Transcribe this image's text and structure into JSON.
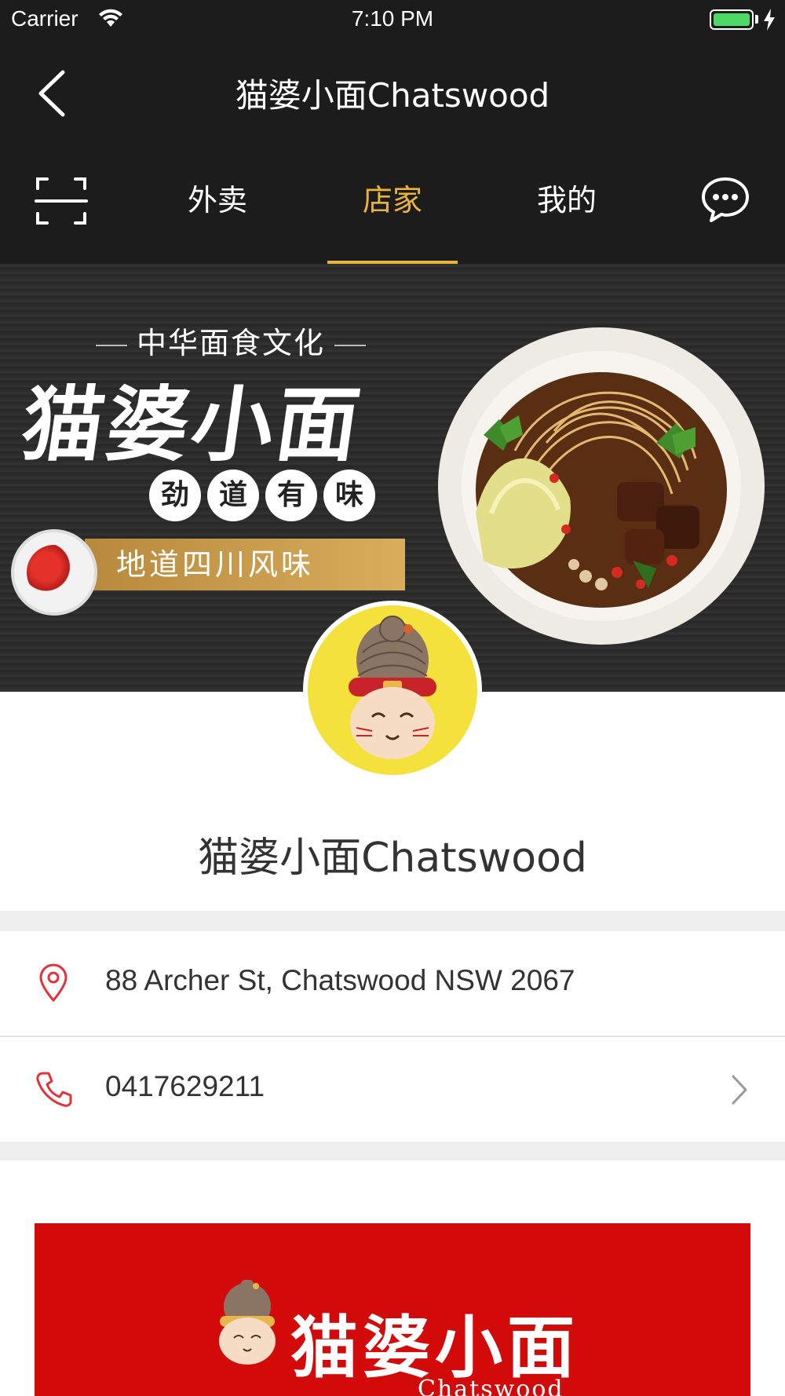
{
  "status_bar": {
    "carrier": "Carrier",
    "time": "7:10 PM",
    "battery_color": "#4cd964"
  },
  "nav": {
    "title": "猫婆小面Chatswood",
    "back_icon": "chevron-left-icon"
  },
  "tabs": {
    "scan_icon": "scan-icon",
    "items": [
      {
        "label": "外卖",
        "active": false
      },
      {
        "label": "店家",
        "active": true
      },
      {
        "label": "我的",
        "active": false
      }
    ],
    "chat_icon": "chat-bubble-icon",
    "accent_color": "#e9b43c"
  },
  "banner": {
    "tagline": "中华面食文化",
    "headline": "猫婆小面",
    "bubbles": [
      "劲",
      "道",
      "有",
      "味"
    ],
    "ribbon": "地道四川风味"
  },
  "shop": {
    "name": "猫婆小面Chatswood",
    "address": "88 Archer St, Chatswood NSW 2067",
    "phone": "0417629211",
    "icon_color": "#e0333a"
  },
  "logo_card": {
    "name": "猫婆小面",
    "sub": "Chatswood",
    "bg_color": "#d30a0a"
  }
}
